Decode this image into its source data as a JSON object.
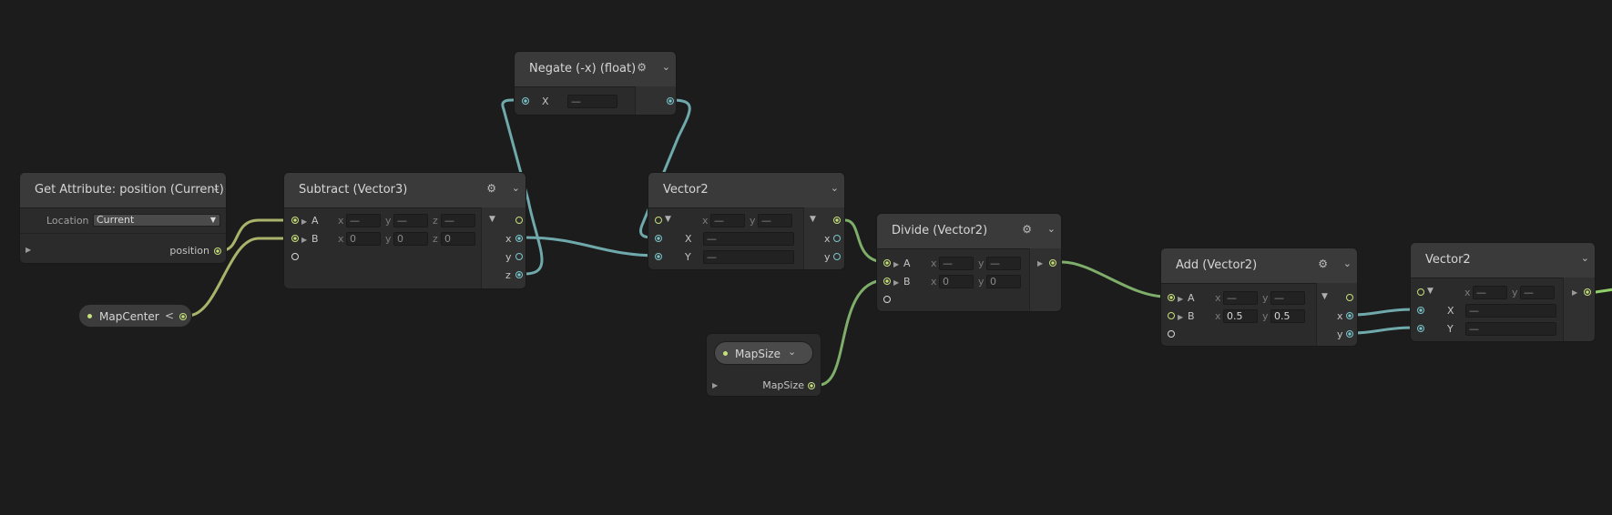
{
  "colors": {
    "vector_port": "#c6e07a",
    "float_port": "#7ac6cc",
    "wire_vector": "#aab36a",
    "wire_float": "#6fa9ab",
    "wire_green": "#7fae6a"
  },
  "nodes": {
    "get_attribute": {
      "title": "Get Attribute: position (Current)",
      "location_label": "Location",
      "location_value": "Current",
      "out_label": "position"
    },
    "map_center": {
      "label": "MapCenter",
      "arrow": "<"
    },
    "subtract": {
      "title": "Subtract (Vector3)",
      "a": "A",
      "b": "B",
      "a_x": "—",
      "a_y": "—",
      "a_z": "—",
      "b_x": "0",
      "b_y": "0",
      "b_z": "0",
      "out_x": "x",
      "out_y": "y",
      "out_z": "z",
      "cx": "x",
      "cy": "y",
      "cz": "z"
    },
    "negate": {
      "title": "Negate (-x) (float)",
      "in_label": "X",
      "in_value": "—"
    },
    "vector2_mid": {
      "title": "Vector2",
      "in_x": "X",
      "in_y": "Y",
      "x_val": "—",
      "y_val": "—",
      "top_x": "—",
      "top_y": "—",
      "out_x": "x",
      "out_y": "y",
      "cx": "x",
      "cy": "y"
    },
    "map_size": {
      "pill_label": "MapSize",
      "out_label": "MapSize"
    },
    "divide": {
      "title": "Divide (Vector2)",
      "a": "A",
      "b": "B",
      "a_x": "—",
      "a_y": "—",
      "b_x": "0",
      "b_y": "0",
      "cx": "x",
      "cy": "y"
    },
    "add": {
      "title": "Add (Vector2)",
      "a": "A",
      "b": "B",
      "a_x": "—",
      "a_y": "—",
      "b_x": "0.5",
      "b_y": "0.5",
      "out_x": "x",
      "out_y": "y",
      "cx": "x",
      "cy": "y"
    },
    "vector2_right": {
      "title": "Vector2",
      "in_x": "X",
      "in_y": "Y",
      "x_val": "—",
      "y_val": "—",
      "top_x": "—",
      "top_y": "—",
      "cx": "x",
      "cy": "y"
    }
  }
}
